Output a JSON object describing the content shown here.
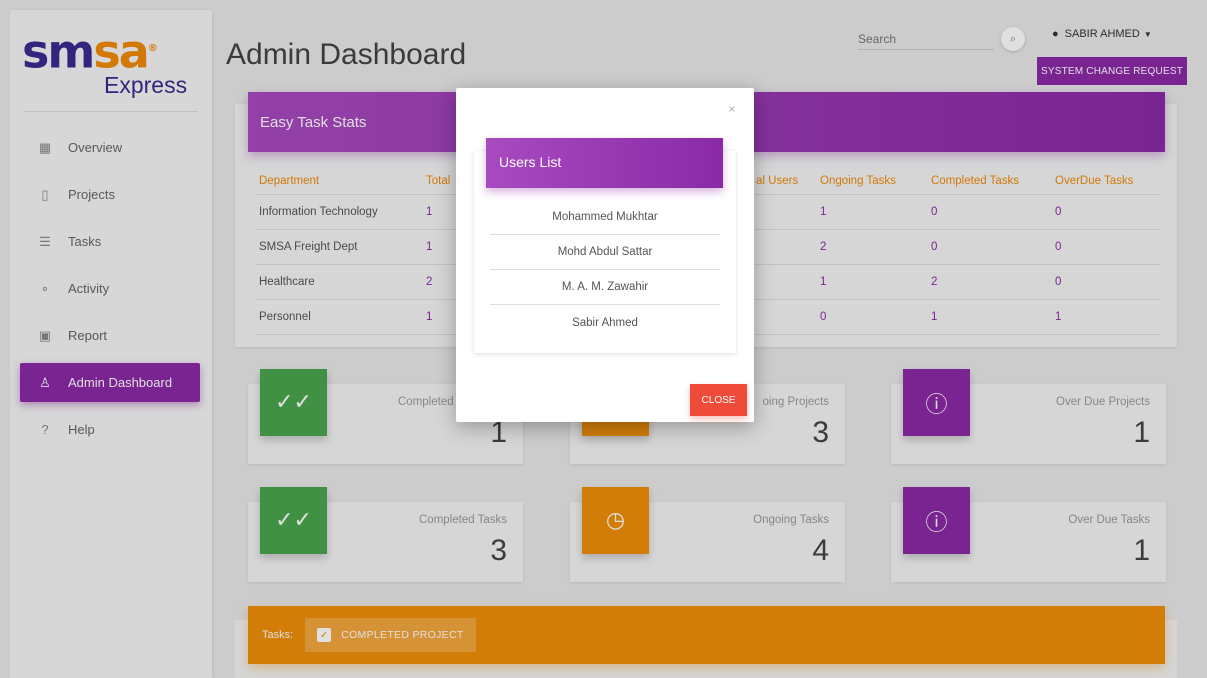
{
  "logo": {
    "mark_part1": "sm",
    "mark_part2": "sa",
    "sub": "Express"
  },
  "sidebar": {
    "items": [
      {
        "label": "Overview",
        "icon": "grid-icon"
      },
      {
        "label": "Projects",
        "icon": "clipboard-icon"
      },
      {
        "label": "Tasks",
        "icon": "list-icon"
      },
      {
        "label": "Activity",
        "icon": "bubbles-icon"
      },
      {
        "label": "Report",
        "icon": "report-icon"
      },
      {
        "label": "Admin Dashboard",
        "icon": "user-icon",
        "active": true
      },
      {
        "label": "Help",
        "icon": "help-icon"
      }
    ]
  },
  "header": {
    "title": "Admin Dashboard",
    "search_placeholder": "Search",
    "user_name": "SABIR AHMED",
    "system_change_label": "SYSTEM CHANGE REQUEST"
  },
  "stats": {
    "title": "Easy Task Stats",
    "columns": [
      "Department",
      "Total",
      "",
      "al Users",
      "Ongoing Tasks",
      "Completed Tasks",
      "OverDue Tasks"
    ],
    "rows": [
      {
        "department": "Information Technology",
        "total": "1",
        "users": "",
        "ongoing": "1",
        "completed": "0",
        "overdue": "0"
      },
      {
        "department": "SMSA Freight Dept",
        "total": "1",
        "users": "",
        "ongoing": "2",
        "completed": "0",
        "overdue": "0"
      },
      {
        "department": "Healthcare",
        "total": "2",
        "users": "",
        "ongoing": "1",
        "completed": "2",
        "overdue": "0"
      },
      {
        "department": "Personnel",
        "total": "1",
        "users": "",
        "ongoing": "0",
        "completed": "1",
        "overdue": "1"
      }
    ]
  },
  "cards": {
    "completed_projects": {
      "label": "Completed",
      "value": "1"
    },
    "ongoing_projects": {
      "label": "oing Projects",
      "value": "3"
    },
    "overdue_projects": {
      "label": "Over Due Projects",
      "value": "1"
    },
    "completed_tasks": {
      "label": "Completed Tasks",
      "value": "3"
    },
    "ongoing_tasks": {
      "label": "Ongoing Tasks",
      "value": "4"
    },
    "overdue_tasks": {
      "label": "Over Due Tasks",
      "value": "1"
    }
  },
  "tasks_bar": {
    "label": "Tasks:",
    "chip": "COMPLETED PROJECT"
  },
  "modal": {
    "close_x": "×",
    "title": "Users List",
    "users": [
      "Mohammed Mukhtar",
      "Mohd Abdul Sattar",
      "M. A. M. Zawahir",
      "Sabir Ahmed"
    ],
    "close_label": "CLOSE"
  },
  "colors": {
    "accent": "#8b2aa6",
    "orange": "#f08f0a",
    "green": "#4aa54e",
    "danger": "#f04a3a"
  }
}
